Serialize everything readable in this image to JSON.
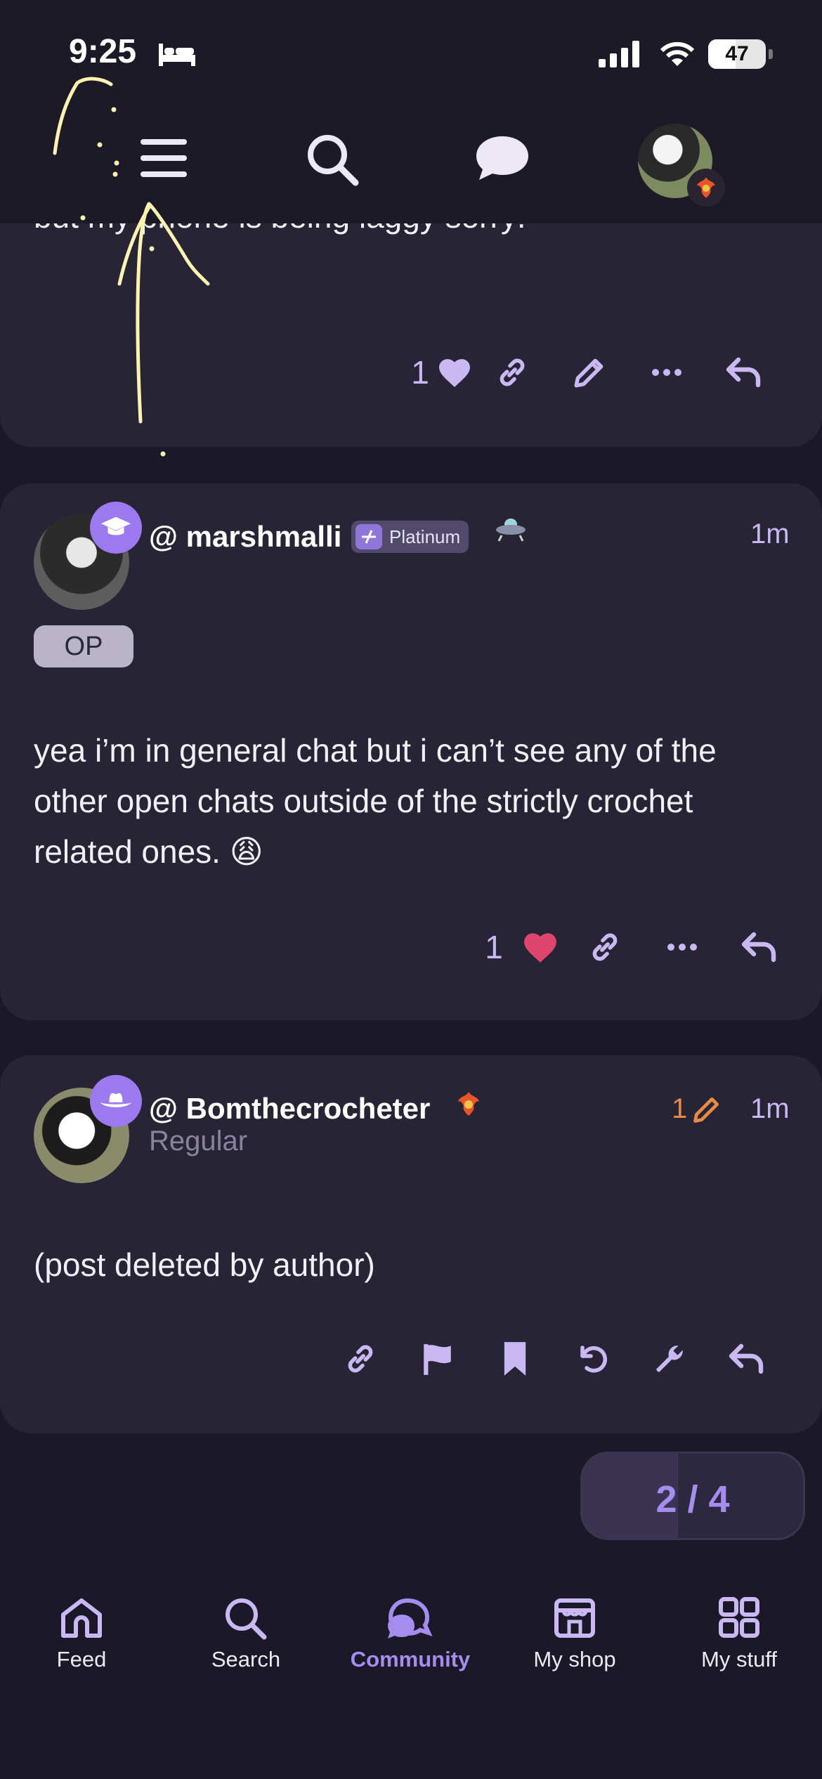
{
  "status_bar": {
    "time": "9:25",
    "battery": "47",
    "battery_level_percent": 47,
    "icons": [
      "bed-icon",
      "cellular-signal-icon",
      "wifi-icon",
      "battery-icon"
    ]
  },
  "top_nav": {
    "icons": [
      "menu-icon",
      "search-icon",
      "chat-bubble-icon",
      "profile-avatar"
    ]
  },
  "posts": [
    {
      "text": "up (adults only I think)ll would tell how to get there but my phone is being laggy sorry:",
      "like_count": "1",
      "actions": [
        "like-icon",
        "link-icon",
        "edit-icon",
        "more-icon",
        "reply-icon"
      ]
    },
    {
      "username": "@ marshmalli",
      "badge": "Platinum",
      "op_label": "OP",
      "timestamp": "1m",
      "text": "yea i’m in general chat but i can’t see any of the other open chats outside of the strictly crochet related ones. 😩",
      "like_count": "1",
      "liked": true,
      "actions": [
        "like-icon",
        "link-icon",
        "more-icon",
        "reply-icon"
      ]
    },
    {
      "username": "@ Bomthecrocheter",
      "level": "Regular",
      "edit_count": "1",
      "timestamp": "1m",
      "text": "(post deleted by author)",
      "actions": [
        "link-icon",
        "flag-icon",
        "bookmark-icon",
        "undo-icon",
        "wrench-icon",
        "reply-icon"
      ]
    }
  ],
  "page_indicator": "2 / 4",
  "tabs": [
    {
      "label": "Feed",
      "icon": "home-icon",
      "active": false
    },
    {
      "label": "Search",
      "icon": "search-icon",
      "active": false
    },
    {
      "label": "Community",
      "icon": "community-icon",
      "active": true
    },
    {
      "label": "My shop",
      "icon": "shop-icon",
      "active": false
    },
    {
      "label": "My stuff",
      "icon": "grid-icon",
      "active": false
    }
  ],
  "colors": {
    "background": "#1b1927",
    "card": "#272435",
    "accent": "#a58df0",
    "icon_lavender": "#c9b8f2",
    "heart_liked": "#e0456e",
    "edit_orange": "#e88a45"
  }
}
